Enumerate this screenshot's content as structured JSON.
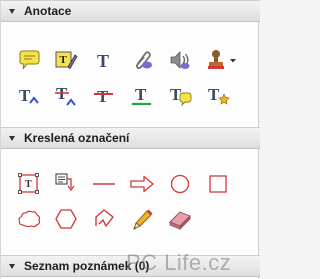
{
  "sections": {
    "annotations": {
      "title": "Anotace"
    },
    "drawing": {
      "title": "Kreslená označení"
    },
    "comments": {
      "title": "Seznam poznámek (0)"
    }
  },
  "annotation_tools": {
    "row1": [
      "sticky-note-icon",
      "text-box-annotation-icon",
      "add-text-icon",
      "attach-file-icon",
      "record-audio-icon",
      "stamp-icon"
    ],
    "row2": [
      "insert-text-icon",
      "replace-text-icon",
      "strikethrough-icon",
      "underline-icon",
      "text-callout-icon",
      "text-format-icon"
    ]
  },
  "drawing_tools": {
    "row1": [
      "text-box-icon",
      "callout-icon",
      "line-icon",
      "arrow-icon",
      "oval-icon",
      "rectangle-icon"
    ],
    "row2": [
      "cloud-icon",
      "polygon-icon",
      "connected-lines-icon",
      "pencil-icon",
      "eraser-icon"
    ]
  },
  "colors": {
    "markup_red": "#d0393b",
    "text_dark": "#1e1e1e",
    "sticky_yellow": "#f6e24a"
  },
  "watermark": "PC Life.cz"
}
